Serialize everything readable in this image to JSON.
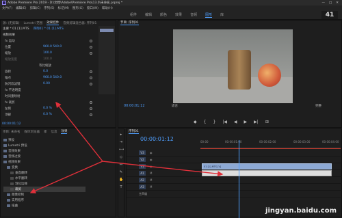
{
  "titlebar": {
    "title": "Adobe Premiere Pro 2019 - D:\\文档\\Adobe\\Premiere Pro\\13.0\\未命名.prproj *",
    "minimize": "—",
    "maximize": "□",
    "close": "✕"
  },
  "menu": [
    "文件(F)",
    "编辑(E)",
    "剪辑(C)",
    "序列(S)",
    "标记(M)",
    "图形(G)",
    "窗口(W)",
    "帮助(H)"
  ],
  "workspace": {
    "tabs": [
      "组件",
      "编辑",
      "颜色",
      "效果",
      "音频",
      "图形",
      "库"
    ],
    "active_index": 5,
    "badge": "41"
  },
  "effect_controls": {
    "tabs": [
      "源: (无剪辑)",
      "Lumetri 范围",
      "效果控件",
      "音频剪辑混合器: 序列01"
    ],
    "active_tab": 2,
    "master": "主要 * 01 [1].MTS",
    "seq": "序列01 * 01 [1].MTS",
    "section": "视频效果",
    "rows": [
      {
        "label": "fx 运动",
        "value": ""
      },
      {
        "label": "位置",
        "value": "960.0  540.0"
      },
      {
        "label": "缩放",
        "value": "100.0"
      },
      {
        "label": "缩放宽度",
        "value": "100.0"
      },
      {
        "label": "等比缩放",
        "value": ""
      },
      {
        "label": "旋转",
        "value": "0.0"
      },
      {
        "label": "锚点",
        "value": "960.0  540.0"
      },
      {
        "label": "防闪烁滤镜",
        "value": "0.00"
      },
      {
        "label": "fx 不透明度",
        "value": ""
      },
      {
        "label": "时间重映射",
        "value": ""
      },
      {
        "label": "fx 裁剪",
        "value": ""
      },
      {
        "label": "左侧",
        "value": "0.0 %"
      },
      {
        "label": "顶部",
        "value": "0.0 %"
      }
    ],
    "timecode": "00:00:01:12"
  },
  "program_monitor": {
    "title": "节目: 序列01",
    "timecode": "00:00:01:12",
    "fit": "适合",
    "full": "完整",
    "controls": [
      "◆",
      "{",
      "}",
      "|◀",
      "◀",
      "▶",
      "▶|",
      "⊞"
    ]
  },
  "project": {
    "tabs": [
      "项目: 未命名",
      "媒体浏览器",
      "库",
      "信息",
      "效果"
    ],
    "active_tab": 4,
    "items": [
      {
        "label": "预设",
        "level": 0,
        "selected": false
      },
      {
        "label": "Lumetri 预设",
        "level": 0,
        "selected": false
      },
      {
        "label": "音频效果",
        "level": 0,
        "selected": false
      },
      {
        "label": "音频过渡",
        "level": 0,
        "selected": false
      },
      {
        "label": "视频效果",
        "level": 0,
        "selected": false
      },
      {
        "label": "变换",
        "level": 1,
        "selected": false
      },
      {
        "label": "垂直翻转",
        "level": 2,
        "selected": false
      },
      {
        "label": "水平翻转",
        "level": 2,
        "selected": false
      },
      {
        "label": "羽化边缘",
        "level": 2,
        "selected": false
      },
      {
        "label": "裁剪",
        "level": 2,
        "selected": true
      },
      {
        "label": "图像控制",
        "level": 1,
        "selected": false
      },
      {
        "label": "实用程序",
        "level": 1,
        "selected": false
      },
      {
        "label": "扭曲",
        "level": 1,
        "selected": false
      }
    ]
  },
  "timeline": {
    "title": "序列01",
    "timecode": "00:00:01:12",
    "ruler": [
      "00:00",
      "00:00:01:00",
      "00:00:02:00",
      "00:00:03:00",
      "00:00:04:00"
    ],
    "tracks": [
      {
        "label": "V3",
        "kind": "video"
      },
      {
        "label": "V2",
        "kind": "video"
      },
      {
        "label": "V1",
        "kind": "video",
        "clip": "01 [1].MTS [V]"
      },
      {
        "label": "A1",
        "kind": "audio",
        "clip": ""
      },
      {
        "label": "A2",
        "kind": "audio"
      },
      {
        "label": "A3",
        "kind": "audio"
      },
      {
        "label": "主声道",
        "kind": "master"
      }
    ]
  },
  "watermark": "jingyan.baidu.com"
}
